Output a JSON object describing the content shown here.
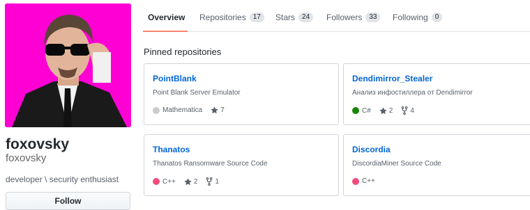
{
  "profile": {
    "full_name": "foxovsky",
    "username": "foxovsky",
    "bio": "developer \\ security enthusiast",
    "follow_label": "Follow",
    "avatar_bg": "#ff00d4"
  },
  "tabs": [
    {
      "label": "Overview",
      "count": null,
      "active": true
    },
    {
      "label": "Repositories",
      "count": "17"
    },
    {
      "label": "Stars",
      "count": "24"
    },
    {
      "label": "Followers",
      "count": "33"
    },
    {
      "label": "Following",
      "count": "0"
    }
  ],
  "pinned_title": "Pinned repositories",
  "repos": [
    {
      "name": "PointBlank",
      "description": "Point Blank Server Emulator",
      "language": "Mathematica",
      "lang_color": "#cccccc",
      "stars": "7",
      "forks": null
    },
    {
      "name": "Dendimirror_Stealer",
      "description": "Анализ инфостиллера от Dendimirror",
      "language": "C#",
      "lang_color": "#178600",
      "stars": "2",
      "forks": "4"
    },
    {
      "name": "Thanatos",
      "description": "Thanatos Ransomware Source Code",
      "language": "C++",
      "lang_color": "#f34b7d",
      "stars": "2",
      "forks": "1"
    },
    {
      "name": "Discordia",
      "description": "DiscordiaMiner Source Code",
      "language": "C++",
      "lang_color": "#f34b7d",
      "stars": null,
      "forks": null
    }
  ],
  "icons": {
    "star": "star-icon",
    "fork": "fork-icon"
  },
  "colors": {
    "link": "#0366d6",
    "active_tab_underline": "#f9826c"
  }
}
